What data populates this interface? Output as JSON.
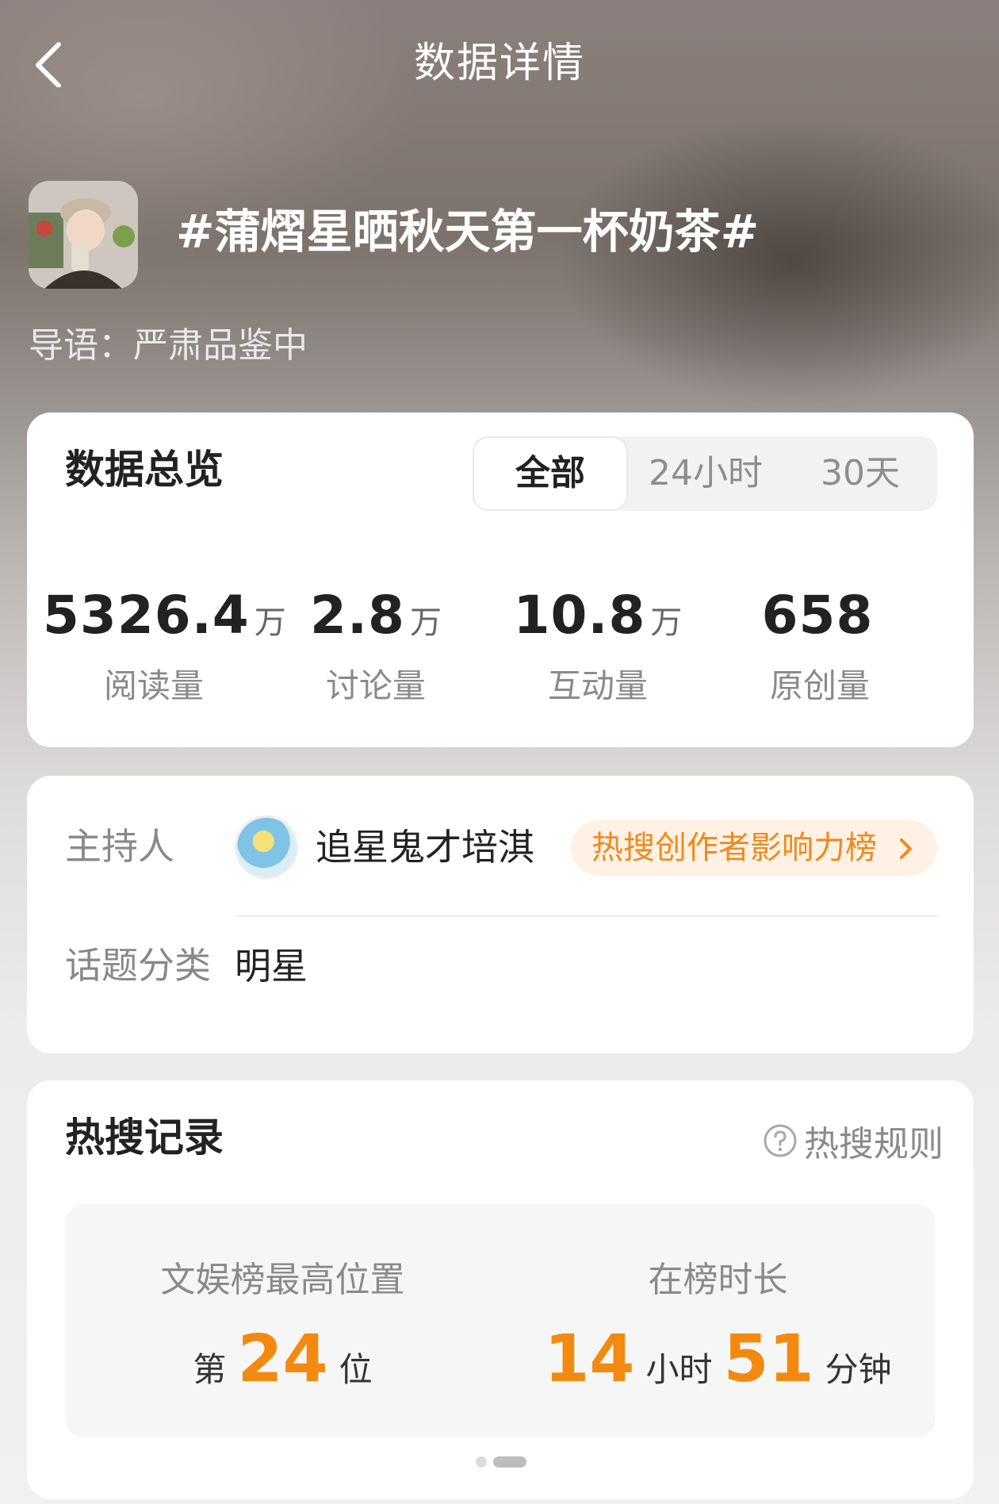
{
  "header": {
    "title": "数据详情"
  },
  "topic": {
    "title": "#蒲熠星晒秋天第一杯奶茶#",
    "guide": "导语：严肃品鉴中"
  },
  "overview": {
    "title": "数据总览",
    "tabs": [
      "全部",
      "24小时",
      "30天"
    ],
    "active_tab": "全部",
    "stats": [
      {
        "value": "5326.4",
        "unit": "万",
        "label": "阅读量"
      },
      {
        "value": "2.8",
        "unit": "万",
        "label": "讨论量"
      },
      {
        "value": "10.8",
        "unit": "万",
        "label": "互动量"
      },
      {
        "value": "658",
        "unit": "",
        "label": "原创量"
      }
    ]
  },
  "host": {
    "label": "主持人",
    "name": "追星鬼才培淇",
    "badge": "热搜创作者影响力榜",
    "category_label": "话题分类",
    "category_value": "明星"
  },
  "records": {
    "title": "热搜记录",
    "rules_link": "热搜规则",
    "highest_position": {
      "label": "文娱榜最高位置",
      "prefix": "第",
      "value": "24",
      "suffix": "位"
    },
    "duration": {
      "label": "在榜时长",
      "hours": "14",
      "hours_unit": "小时",
      "minutes": "51",
      "minutes_unit": "分钟"
    },
    "pager": {
      "pages": 2,
      "active_page": 2
    }
  },
  "colors": {
    "accent_orange": "#f38a0f",
    "badge_bg": "#fff1e4",
    "badge_text": "#f08a1d"
  }
}
